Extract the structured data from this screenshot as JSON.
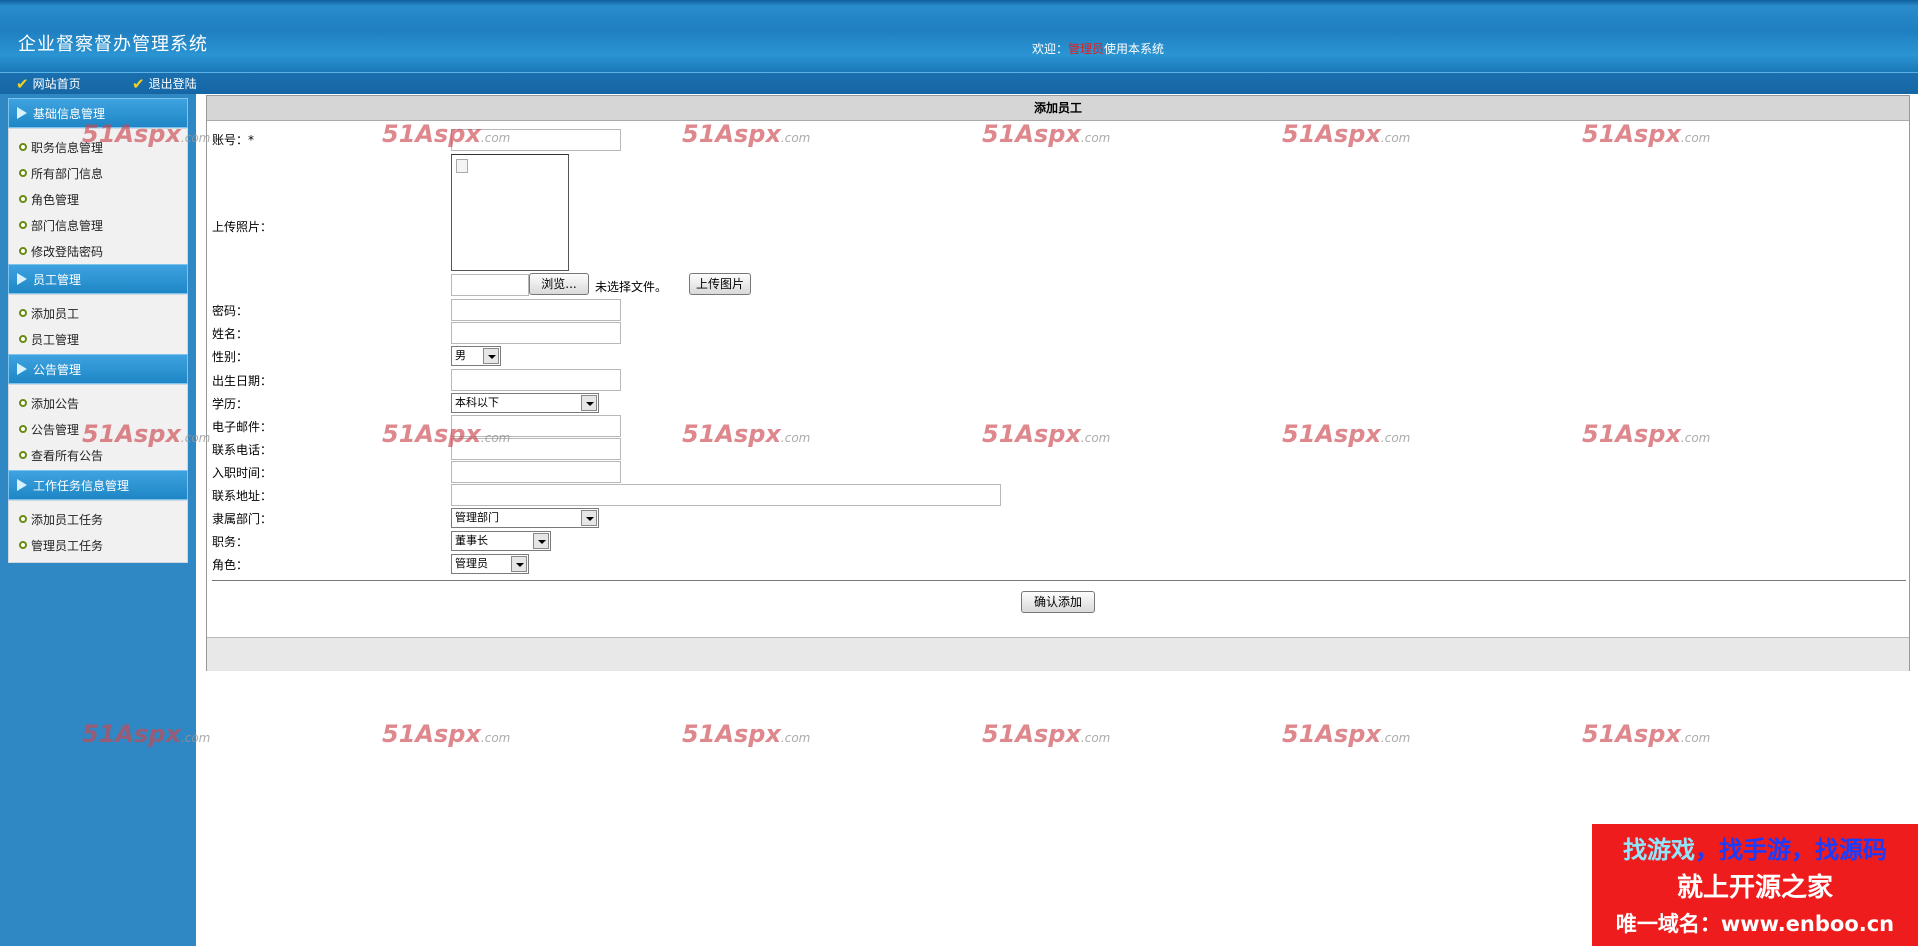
{
  "header": {
    "app_title": "企业督察督办管理系统",
    "welcome_prefix": "欢迎：",
    "welcome_user": "管理员",
    "welcome_suffix": "使用本系统"
  },
  "nav": {
    "home_label": "网站首页",
    "logout_label": "退出登陆"
  },
  "sidebar": {
    "groups": [
      {
        "title": "基础信息管理",
        "items": [
          "职务信息管理",
          "所有部门信息",
          "角色管理",
          "部门信息管理",
          "修改登陆密码"
        ]
      },
      {
        "title": "员工管理",
        "items": [
          "添加员工",
          "员工管理"
        ]
      },
      {
        "title": "公告管理",
        "items": [
          "添加公告",
          "公告管理",
          "查看所有公告"
        ]
      },
      {
        "title": "工作任务信息管理",
        "items": [
          "添加员工任务",
          "管理员工任务"
        ]
      }
    ]
  },
  "form": {
    "title": "添加员工",
    "labels": {
      "account": "账号：*",
      "photo": "上传照片：",
      "password": "密码：",
      "name": "姓名：",
      "gender": "性别：",
      "birthdate": "出生日期：",
      "education": "学历：",
      "email": "电子邮件：",
      "phone": "联系电话：",
      "hire_date": "入职时间：",
      "address": "联系地址：",
      "department": "隶属部门：",
      "position": "职务：",
      "role": "角色："
    },
    "values": {
      "gender": "男",
      "education": "本科以下",
      "department": "管理部门",
      "position": "董事长",
      "role": "管理员"
    },
    "browse_button": "浏览...",
    "no_file_text": "未选择文件。",
    "upload_button": "上传图片",
    "submit_button": "确认添加"
  },
  "watermark": {
    "brand": "51Aspx",
    "suffix": ".com"
  },
  "ad_banner": {
    "line1_a": "找游戏",
    "line1_b": "，找手游，找源码",
    "line2": "就上开源之家",
    "line3": "唯一域名：www.enboo.cn"
  }
}
